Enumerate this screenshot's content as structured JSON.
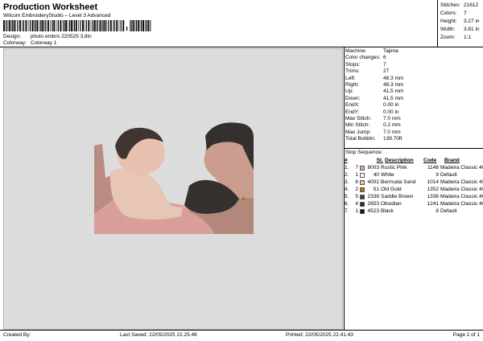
{
  "header": {
    "title": "Production Worksheet",
    "subtitle": "Wilcom EmbroideryStudio – Level 3 Advanced",
    "design_label": "Design:",
    "design_value": "photo embro 220525 3,8in",
    "colorway_label": "Colorway:",
    "colorway_value": "Colorway 1"
  },
  "stats": [
    {
      "label": "Stitches:",
      "value": "21612"
    },
    {
      "label": "Colors:",
      "value": "7"
    },
    {
      "label": "Height:",
      "value": "3.27 in"
    },
    {
      "label": "Width:",
      "value": "3.81 in"
    },
    {
      "label": "Zoom:",
      "value": "1:1"
    }
  ],
  "machine_info": [
    {
      "label": "Machine:",
      "value": "Tajima"
    },
    {
      "label": "Color changes:",
      "value": "6"
    },
    {
      "label": "Stops:",
      "value": "7"
    },
    {
      "label": "Trims:",
      "value": "27"
    },
    {
      "label": "Left:",
      "value": "48.3 mm"
    },
    {
      "label": "Right:",
      "value": "48.3 mm"
    },
    {
      "label": "Up:",
      "value": "41.5 mm"
    },
    {
      "label": "Down:",
      "value": "41.5 mm"
    },
    {
      "label": "EndX:",
      "value": "0.00 in"
    },
    {
      "label": "EndY:",
      "value": "0.00 in"
    },
    {
      "label": "Max Stitch:",
      "value": "7.0 mm"
    },
    {
      "label": "Min Stitch:",
      "value": "0.2 mm"
    },
    {
      "label": "Max Jump:",
      "value": "7.0 mm"
    },
    {
      "label": "Total Bobbin:",
      "value": "139.70ft"
    }
  ],
  "stop_sequence": {
    "title": "Stop Sequence:",
    "headers": {
      "num": "#",
      "st": "St.",
      "desc": "Description",
      "code": "Code",
      "brand": "Brand"
    },
    "rows": [
      {
        "num": "1.",
        "stop": "7",
        "color": "#e8a9a6",
        "code": "8003",
        "desc": "Rustic Pink",
        "stitches": "1148",
        "brand": "Madeira Classic 40"
      },
      {
        "num": "2.",
        "stop": "1",
        "color": "#ffffff",
        "code": "40",
        "desc": "White",
        "stitches": "9",
        "brand": "Default"
      },
      {
        "num": "3.",
        "stop": "6",
        "color": "#e7bfae",
        "code": "4002",
        "desc": "Bermuda Sand",
        "stitches": "1014",
        "brand": "Madeira Classic 40"
      },
      {
        "num": "4.",
        "stop": "2",
        "color": "#b0761a",
        "code": "51",
        "desc": "Old Gold",
        "stitches": "1352",
        "brand": "Madeira Classic 40"
      },
      {
        "num": "5.",
        "stop": "5",
        "color": "#4e3a33",
        "code": "2338",
        "desc": "Saddle Brown",
        "stitches": "1336",
        "brand": "Madeira Classic 40"
      },
      {
        "num": "6.",
        "stop": "4",
        "color": "#2f2d2c",
        "code": "2653",
        "desc": "Obsidian",
        "stitches": "1241",
        "brand": "Madeira Classic 40"
      },
      {
        "num": "7.",
        "stop": "1",
        "color": "#0f0f0f",
        "code": "4523",
        "desc": "Black",
        "stitches": "8",
        "brand": "Default"
      }
    ]
  },
  "footer": {
    "created": "Created By:",
    "saved": "Last Saved: 22/05/2025 22.25.46",
    "printed": "Printed: 22/05/2025 22.41.43",
    "page": "Page 1 of 1"
  }
}
